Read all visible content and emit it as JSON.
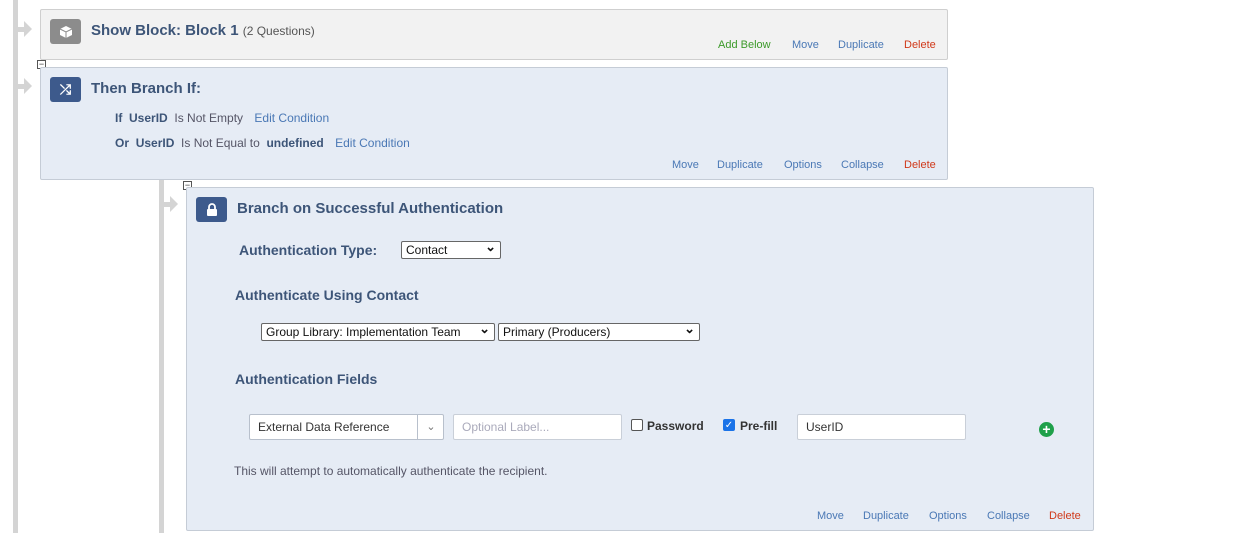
{
  "show_block": {
    "title": "Show Block: Block 1",
    "subtitle": "(2 Questions)",
    "actions": {
      "add_below": "Add Below",
      "move": "Move",
      "duplicate": "Duplicate",
      "delete": "Delete"
    }
  },
  "branch": {
    "title": "Then Branch If:",
    "conditions": [
      {
        "conj": "If",
        "field": "UserID",
        "op": "Is Not Empty",
        "value": "",
        "edit": "Edit Condition"
      },
      {
        "conj": "Or",
        "field": "UserID",
        "op": "Is Not Equal to",
        "value": "undefined",
        "edit": "Edit Condition"
      }
    ],
    "actions": {
      "move": "Move",
      "duplicate": "Duplicate",
      "options": "Options",
      "collapse": "Collapse",
      "delete": "Delete"
    }
  },
  "auth": {
    "title": "Branch on Successful Authentication",
    "type_label": "Authentication Type:",
    "type_value": "Contact",
    "using_heading": "Authenticate Using Contact",
    "library_value": "Group Library: Implementation Team",
    "list_value": "Primary (Producers)",
    "fields_heading": "Authentication Fields",
    "field_type": "External Data Reference",
    "label_placeholder": "Optional Label...",
    "password_label": "Password",
    "password_checked": false,
    "prefill_label": "Pre-fill",
    "prefill_checked": true,
    "prefill_value": "UserID",
    "note": "This will attempt to automatically authenticate the recipient.",
    "actions": {
      "move": "Move",
      "duplicate": "Duplicate",
      "options": "Options",
      "collapse": "Collapse",
      "delete": "Delete"
    }
  },
  "colors": {
    "accent_blue": "#3d5a8c",
    "link": "#4a78b5",
    "delete": "#d0391a",
    "add": "#3c9a2a"
  }
}
